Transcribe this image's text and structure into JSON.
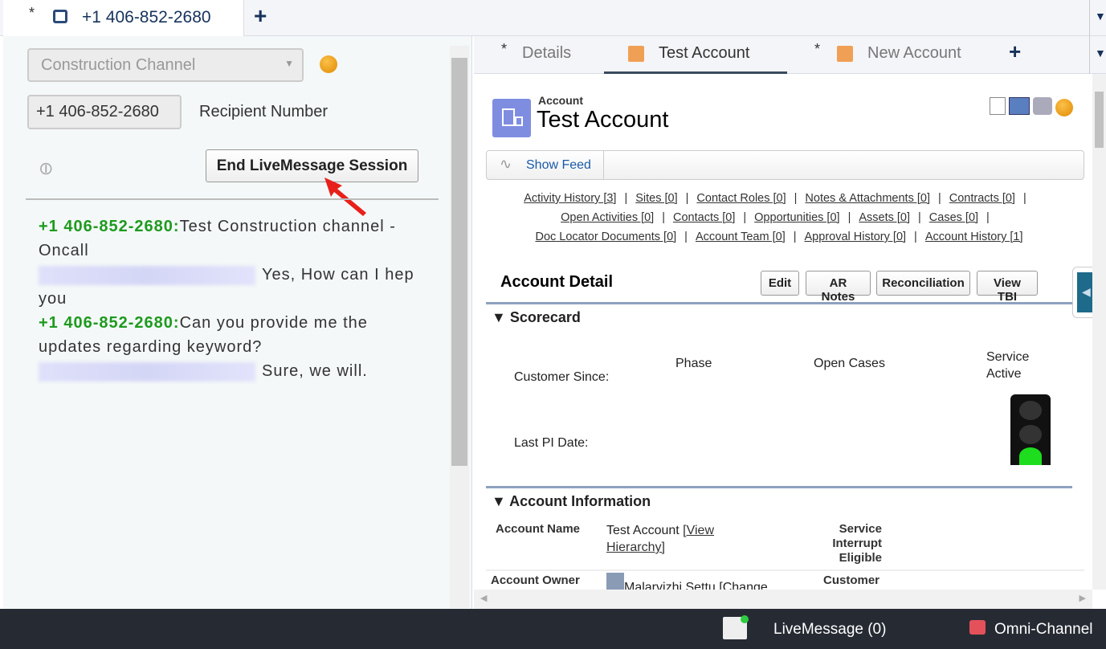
{
  "primary_tabs": {
    "active": {
      "dirty_marker": "*",
      "icon": "livemessage-icon",
      "label": "+1 406-852-2680"
    },
    "add_label": "+"
  },
  "left": {
    "channel_select": {
      "value": "Construction Channel"
    },
    "help_label": "?",
    "recipient": {
      "value": "+1 406-852-2680",
      "label": "Recipient Number"
    },
    "end_session_label": "End LiveMessage Session",
    "messages": [
      {
        "sender": "+1 406-852-2680:",
        "text": "Test Construction channel - Oncall"
      },
      {
        "sender": "",
        "text": "Yes, How can I hep you",
        "redacted": true
      },
      {
        "sender": "+1 406-852-2680:",
        "text": "Can you provide me the updates regarding keyword?"
      },
      {
        "sender": "",
        "text": "Sure, we will.",
        "redacted": true
      }
    ]
  },
  "subtabs": [
    {
      "dirty": "*",
      "label": "Details"
    },
    {
      "dirty": "",
      "label": "Test Account",
      "active": true
    },
    {
      "dirty": "*",
      "label": "New Account"
    }
  ],
  "subtab_add": "+",
  "record": {
    "object_label": "Account",
    "title": "Test Account",
    "show_feed": "Show Feed",
    "related_rows": [
      [
        "Activity History [3]",
        "Sites [0]",
        "Contact Roles [0]",
        "Notes & Attachments [0]",
        "Contracts [0]"
      ],
      [
        "Open Activities [0]",
        "Contacts [0]",
        "Opportunities [0]",
        "Assets [0]",
        "Cases [0]"
      ],
      [
        "Doc Locator Documents [0]",
        "Account Team [0]",
        "Approval History [0]",
        "Account History [1]"
      ]
    ],
    "detail_title": "Account Detail",
    "buttons": [
      "Edit",
      "AR Notes",
      "Reconciliation",
      "View TBI"
    ],
    "scorecard": {
      "title": "Scorecard",
      "customer_since": "Customer Since:",
      "phase": "Phase",
      "open_cases": "Open Cases",
      "service_active": "Service Active",
      "last_pi": "Last PI Date:",
      "traffic_light": "green"
    },
    "account_info": {
      "title": "Account Information",
      "account_name_label": "Account Name",
      "account_name_value": "Test Account",
      "view_hierarchy": "[View Hierarchy]",
      "service_interrupt_label": "Service Interrupt Eligible",
      "owner_label": "Account Owner",
      "owner_value": "Malarvizhi Settu [Change",
      "customer_label": "Customer"
    }
  },
  "footer": {
    "livemessage": "LiveMessage (0)",
    "omni": "Omni-Channel"
  },
  "colors": {
    "sender": "#1e9a1e",
    "footer_bg": "#262b33",
    "account_icon": "#7f8de1"
  }
}
